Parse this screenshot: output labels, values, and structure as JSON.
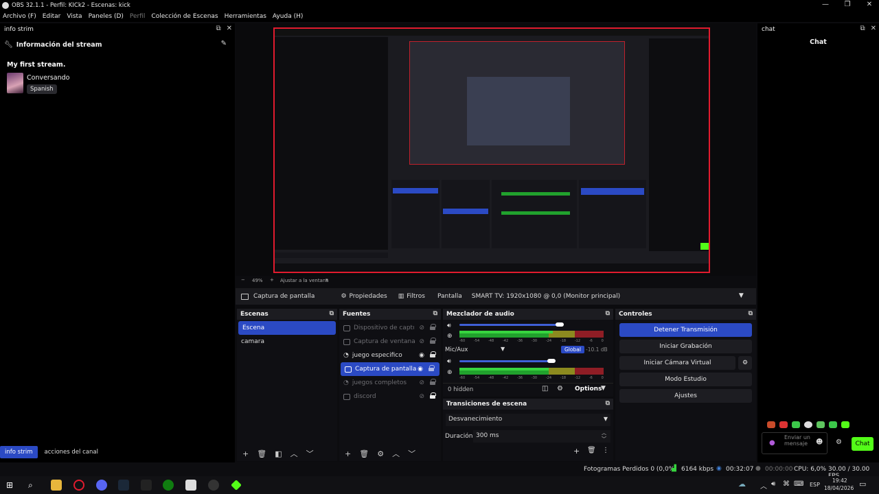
{
  "window": {
    "title": "OBS 32.1.1 - Perfil: KICk2 - Escenas: kick"
  },
  "menu": [
    "Archivo (F)",
    "Editar",
    "Vista",
    "Paneles (D)",
    "Perfil",
    "Colección de Escenas",
    "Herramientas",
    "Ayuda (H)"
  ],
  "left_dock": {
    "title": "info strim",
    "section_title": "Información del stream",
    "stream_title": "My first stream.",
    "category": "Conversando",
    "language": "Spanish",
    "tabs": [
      "info strim",
      "acciones del canal"
    ]
  },
  "preview": {
    "zoom": "49%",
    "fit_label": "Ajustar a la ventana"
  },
  "source_toolbar": {
    "source_name": "Captura de pantalla",
    "properties": "Propiedades",
    "filters": "Filtros",
    "display_label": "Pantalla",
    "display_value": "SMART TV: 1920x1080 @ 0,0 (Monitor principal)"
  },
  "scenes": {
    "title": "Escenas",
    "items": [
      "Escena",
      "camara"
    ]
  },
  "sources": {
    "title": "Fuentes",
    "items": [
      {
        "label": "Dispositivo de captura",
        "state": "hidden"
      },
      {
        "label": "Captura de ventana",
        "state": "hidden"
      },
      {
        "label": "juego especifico",
        "state": "visible"
      },
      {
        "label": "Captura de pantalla",
        "state": "selected"
      },
      {
        "label": "juegos completos",
        "state": "hidden"
      },
      {
        "label": "discord",
        "state": "hidden-locked"
      }
    ]
  },
  "mixer": {
    "title": "Mezclador de audio",
    "ticks": [
      "-60",
      "-54",
      "-48",
      "-42",
      "-36",
      "-30",
      "-24",
      "-18",
      "-12",
      "-6",
      "0"
    ],
    "channel2_name": "Mic/Aux",
    "global_label": "Global",
    "db_value": "-10.1 dB",
    "hidden_count": "0 hidden",
    "options_label": "Options"
  },
  "transitions": {
    "title": "Transiciones de escena",
    "transition": "Desvanecimiento",
    "duration_label": "Duración",
    "duration_value": "300 ms"
  },
  "controls": {
    "title": "Controles",
    "buttons": [
      "Detener Transmisión",
      "Iniciar Grabación",
      "Iniciar Cámara Virtual",
      "Modo Estudio",
      "Ajustes"
    ]
  },
  "chat": {
    "dock_title": "chat",
    "header": "Chat",
    "input_placeholder": "Enviar un mensaje",
    "send_label": "Chat"
  },
  "status": {
    "dropped_frames": "Fotogramas Perdidos 0 (0,0%)",
    "bitrate": "6164 kbps",
    "stream_time": "00:32:07",
    "rec_time": "00:00:00",
    "cpu": "CPU: 6,0%",
    "fps": "30.00 / 30.00 FPS"
  },
  "taskbar": {
    "language": "ESP",
    "time": "19:42",
    "date": "18/04/2026"
  },
  "colors": {
    "accent": "#2b4ac4",
    "red_border": "#e21b2e",
    "chat_green": "#53fc18"
  }
}
